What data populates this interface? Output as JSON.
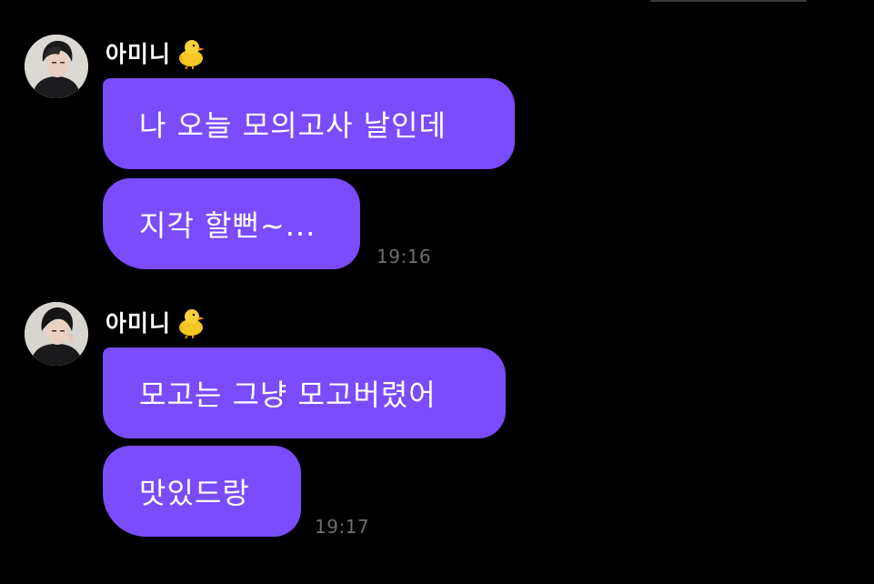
{
  "groups": [
    {
      "sender": "아미니",
      "sender_emoji": "chick-icon",
      "messages": [
        "나 오늘 모의고사 날인데",
        "지각 할뻔~..."
      ],
      "time": "19:16"
    },
    {
      "sender": "아미니",
      "sender_emoji": "chick-icon",
      "messages": [
        "모고는 그냥 모고버렸어",
        "맛있드랑"
      ],
      "time": "19:17"
    }
  ],
  "colors": {
    "background": "#000000",
    "bubble": "#7a4cfb",
    "timestamp": "#6e6e6e",
    "text": "#ffffff"
  }
}
